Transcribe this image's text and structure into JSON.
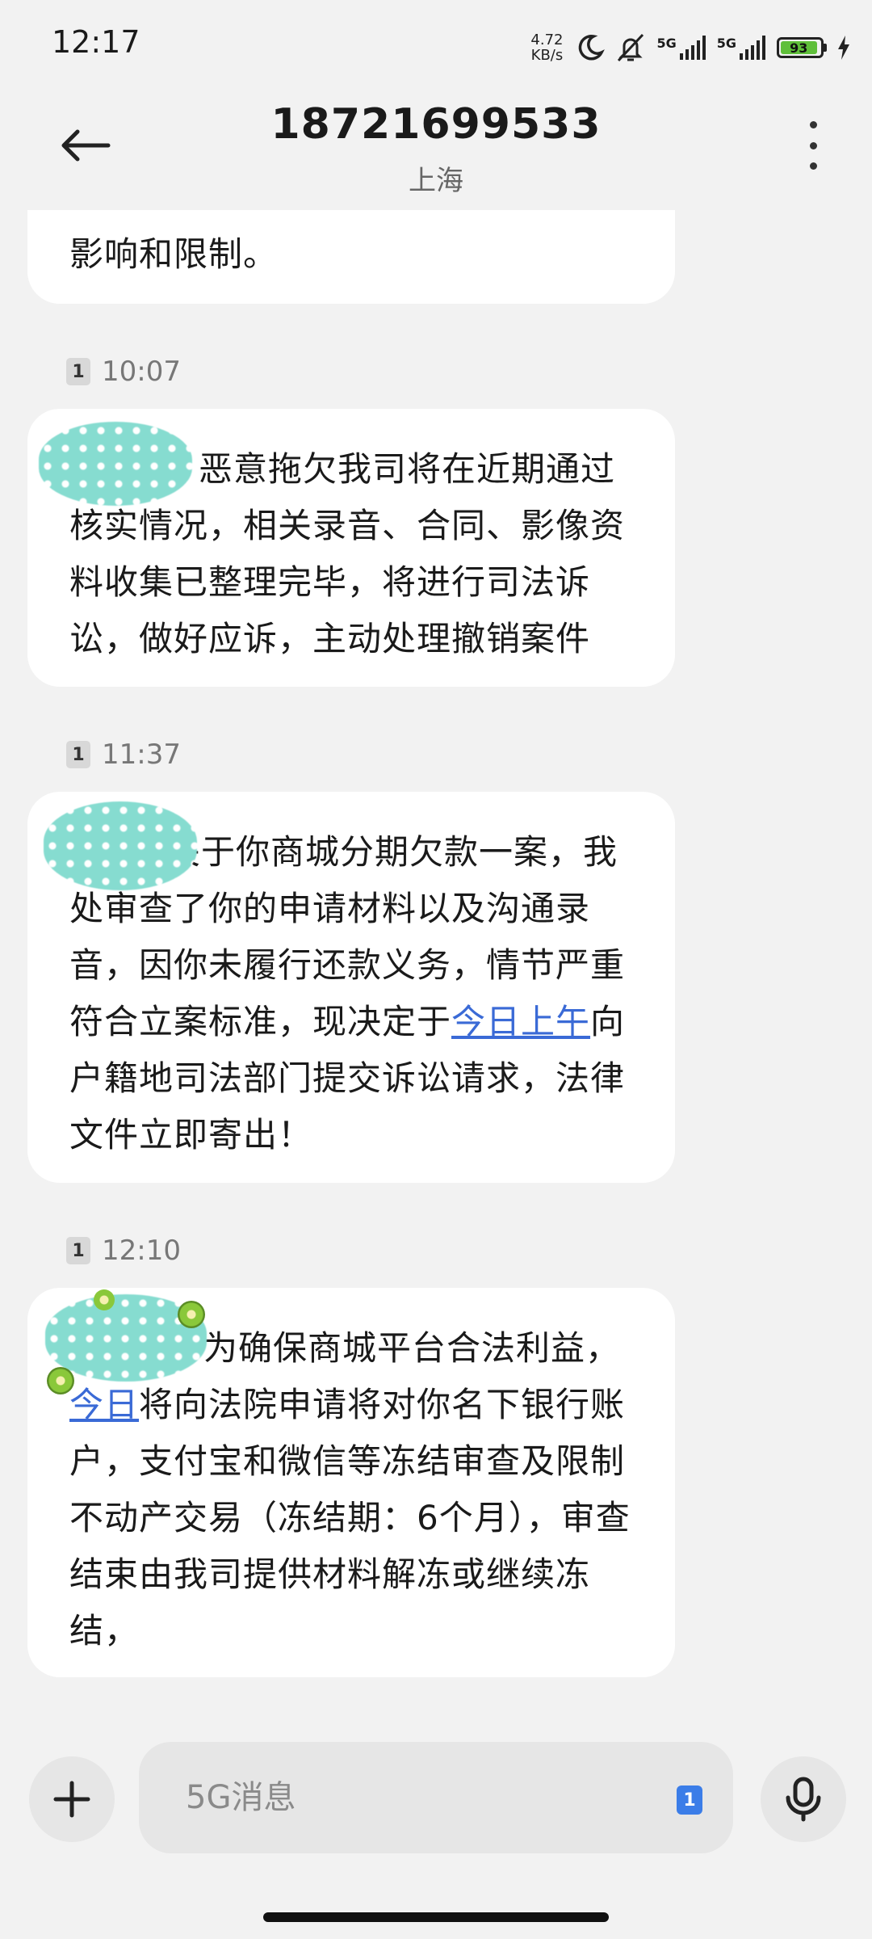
{
  "status_bar": {
    "time": "12:17",
    "net_speed_value": "4.72",
    "net_speed_unit": "KB/s",
    "sim1_label": "5G",
    "sim2_label": "5G",
    "battery_level": "93",
    "battery_color": "#5fbf3a"
  },
  "header": {
    "contact_number": "18721699533",
    "contact_location": "上海",
    "icons": [
      "back-arrow-icon",
      "more-vert-icon"
    ]
  },
  "messages": [
    {
      "partial_top": true,
      "text": "影响和限制。"
    },
    {
      "sim": "1",
      "time": "10:07",
      "text": "恶意拖欠我司将在近期通过核实情况，相关录音、合同、影像资料收集已整理完毕，将进行司法诉讼，做好应诉，主动处理撤销案件"
    },
    {
      "sim": "1",
      "time": "11:37",
      "text_before_link": "关于你商城分期欠款一案，我处审查了你的申请材料以及沟通录音，因你未履行还款义务，情节严重符合立案标准，现决定于",
      "link": "今日上午",
      "text_after_link": "向户籍地司法部门提交诉讼请求，法律文件立即寄出！"
    },
    {
      "sim": "1",
      "time": "12:10",
      "text_before_link": "为确保商城平台合法利益，",
      "link": "今日",
      "text_after_link": "将向法院申请将对你名下银行账户，支付宝和微信等冻结审查及限制不动产交易（冻结期：6个月），审查结束由我司提供材料解冻或继续冻结，"
    }
  ],
  "input": {
    "placeholder": "5G消息",
    "sim_selected": "1",
    "sim_color": "#3b7de8",
    "icons": [
      "plus-icon",
      "mic-icon"
    ]
  }
}
